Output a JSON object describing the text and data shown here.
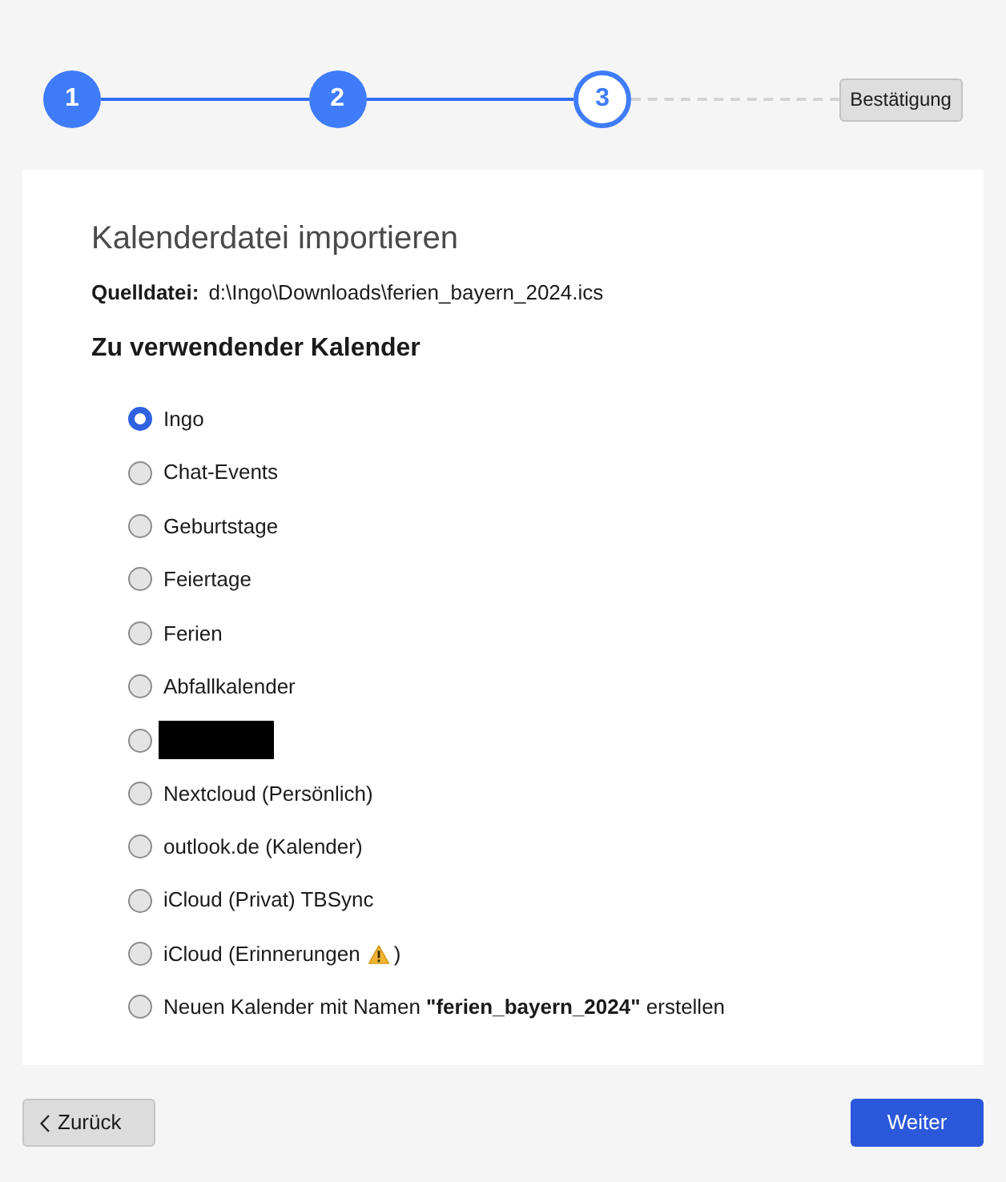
{
  "stepper": {
    "steps": [
      {
        "kind": "number",
        "label": "1",
        "completed": true,
        "current": false
      },
      {
        "kind": "number",
        "label": "2",
        "completed": true,
        "current": false
      },
      {
        "kind": "number",
        "label": "3",
        "completed": false,
        "current": true
      },
      {
        "kind": "label",
        "label": "Bestätigung",
        "completed": false,
        "current": false
      }
    ]
  },
  "dialog": {
    "title": "Kalenderdatei importieren",
    "source": {
      "label": "Quelldatei:",
      "value": "d:\\Ingo\\Downloads\\ferien_bayern_2024.ics"
    },
    "section_heading": "Zu verwendender Kalender",
    "calendars": [
      {
        "kind": "text",
        "label": "Ingo",
        "selected": true
      },
      {
        "kind": "text",
        "label": "Chat-Events",
        "selected": false
      },
      {
        "kind": "text",
        "label": "Geburtstage",
        "selected": false
      },
      {
        "kind": "text",
        "label": "Feiertage",
        "selected": false
      },
      {
        "kind": "text",
        "label": "Ferien",
        "selected": false
      },
      {
        "kind": "text",
        "label": "Abfallkalender",
        "selected": false
      },
      {
        "kind": "redacted",
        "selected": false
      },
      {
        "kind": "text",
        "label": "Nextcloud (Persönlich)",
        "selected": false
      },
      {
        "kind": "text",
        "label": "outlook.de (Kalender)",
        "selected": false
      },
      {
        "kind": "text",
        "label": "iCloud (Privat) TBSync",
        "selected": false
      },
      {
        "kind": "warning",
        "label": "iCloud (Erinnerungen",
        "label_after": ")",
        "selected": false
      },
      {
        "kind": "text",
        "label": "Neuen Kalender mit Namen **\"ferien_bayern_2024\"** erstellen",
        "selected": false
      }
    ]
  },
  "buttons": {
    "back": "Zurück",
    "next": "Weiter"
  }
}
